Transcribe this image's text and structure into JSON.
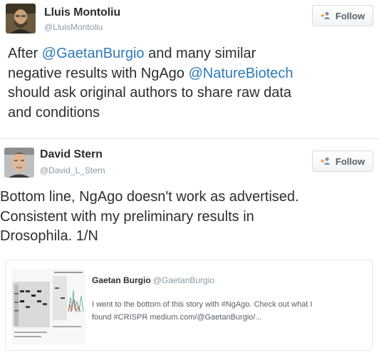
{
  "tweets": [
    {
      "name": "Lluis Montoliu",
      "handle": "@LluisMontoliu",
      "follow_label": "Follow",
      "avatar_icon": "person-photo-icon",
      "text_lines": [
        [
          {
            "t": "After "
          },
          {
            "t": "@GaetanBurgio",
            "m": true
          },
          {
            "t": " and many similar"
          }
        ],
        [
          {
            "t": "negative results with NgAgo "
          },
          {
            "t": "@NatureBiotech",
            "m": true
          }
        ],
        [
          {
            "t": "should ask original authors to share raw data"
          }
        ],
        [
          {
            "t": "and conditions"
          }
        ]
      ]
    },
    {
      "name": "David Stern",
      "handle": "@David_L_Stern",
      "follow_label": "Follow",
      "avatar_icon": "person-photo-icon",
      "text_lines": [
        [
          {
            "t": "Bottom line, NgAgo doesn't work as advertised."
          }
        ],
        [
          {
            "t": "Consistent with my preliminary results in"
          }
        ],
        [
          {
            "t": "Drosophila. 1/N"
          }
        ]
      ]
    }
  ],
  "quoted": {
    "name": "Gaetan Burgio",
    "handle": "@GaetanBurgio",
    "text_lines": [
      "I went to the bottom of this story with #NgAgo. Check out what I",
      "found #CRISPR medium.com/@GaetanBurgio/..."
    ],
    "image_icon": "gel-electrophoresis-image-icon"
  },
  "colors": {
    "text": "#292f33",
    "muted": "#8899a6",
    "link": "#2b7bb9",
    "border": "#e1e8ed"
  },
  "icons": {
    "follow": "follow-user-icon"
  }
}
